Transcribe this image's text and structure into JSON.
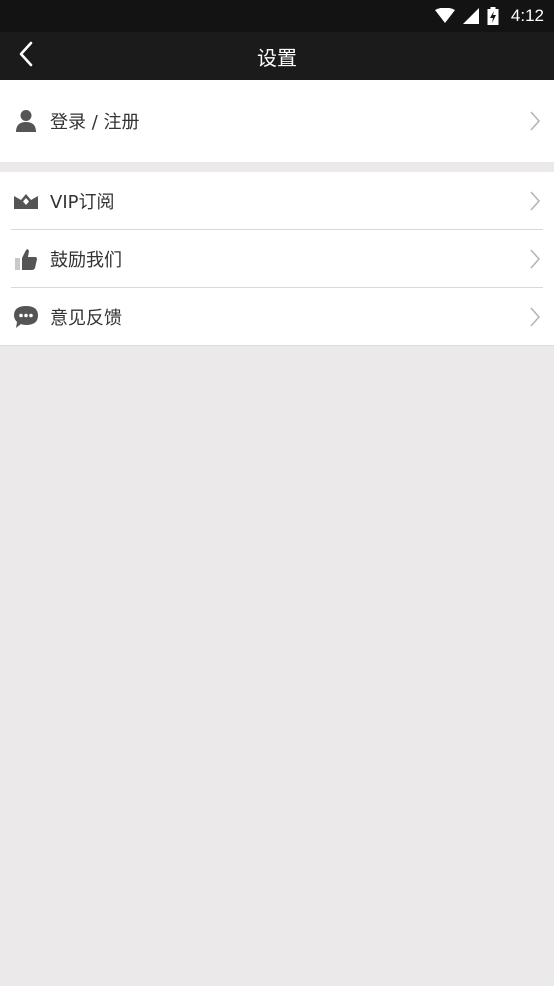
{
  "status_bar": {
    "time": "4:12",
    "icons": [
      "wifi-icon",
      "signal-icon",
      "battery-icon"
    ]
  },
  "app_bar": {
    "title": "设置",
    "back_icon": "back-arrow-icon"
  },
  "login": {
    "label": "登录 / 注册",
    "icon": "user-icon"
  },
  "menu": {
    "items": [
      {
        "label": "VIP订阅",
        "icon": "vip-crown-icon"
      },
      {
        "label": "鼓励我们",
        "icon": "thumbs-up-icon"
      },
      {
        "label": "意见反馈",
        "icon": "chat-bubble-icon"
      }
    ]
  },
  "colors": {
    "status_bar": "#131313",
    "app_bar": "#1b1b1b",
    "background": "#ebe9ea",
    "icon": "#555555"
  }
}
